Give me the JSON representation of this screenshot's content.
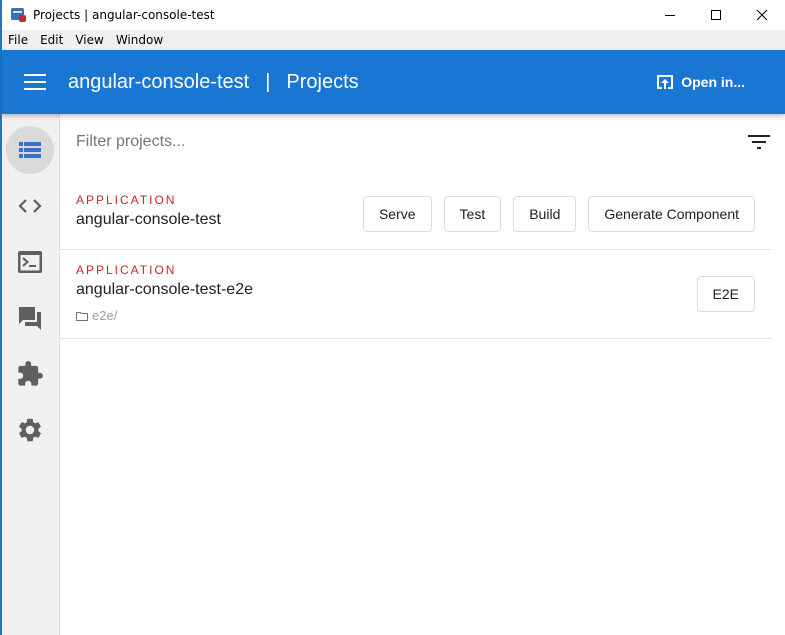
{
  "window": {
    "title": "Projects | angular-console-test",
    "controls": {
      "minimize": "minimize-icon",
      "maximize": "maximize-icon",
      "close": "close-icon"
    }
  },
  "menubar": {
    "items": [
      {
        "label": "File"
      },
      {
        "label": "Edit"
      },
      {
        "label": "View"
      },
      {
        "label": "Window"
      }
    ]
  },
  "header": {
    "workspace": "angular-console-test",
    "separator": "|",
    "page": "Projects",
    "open_in_label": "Open in...",
    "accent_color": "#1976d2"
  },
  "sidebar": {
    "items": [
      {
        "name": "projects",
        "icon": "list-icon",
        "active": true
      },
      {
        "name": "generate",
        "icon": "code-icon",
        "active": false
      },
      {
        "name": "tasks",
        "icon": "terminal-icon",
        "active": false
      },
      {
        "name": "support",
        "icon": "forum-icon",
        "active": false
      },
      {
        "name": "extensions",
        "icon": "extension-icon",
        "active": false
      },
      {
        "name": "settings",
        "icon": "gear-icon",
        "active": false
      }
    ]
  },
  "main": {
    "filter": {
      "placeholder": "Filter projects...",
      "value": ""
    },
    "projects": [
      {
        "type": "APPLICATION",
        "name": "angular-console-test",
        "actions": [
          "Serve",
          "Test",
          "Build",
          "Generate Component"
        ]
      },
      {
        "type": "APPLICATION",
        "name": "angular-console-test-e2e",
        "root": "e2e/",
        "actions": [
          "E2E"
        ]
      }
    ],
    "type_color": "#c62828"
  }
}
